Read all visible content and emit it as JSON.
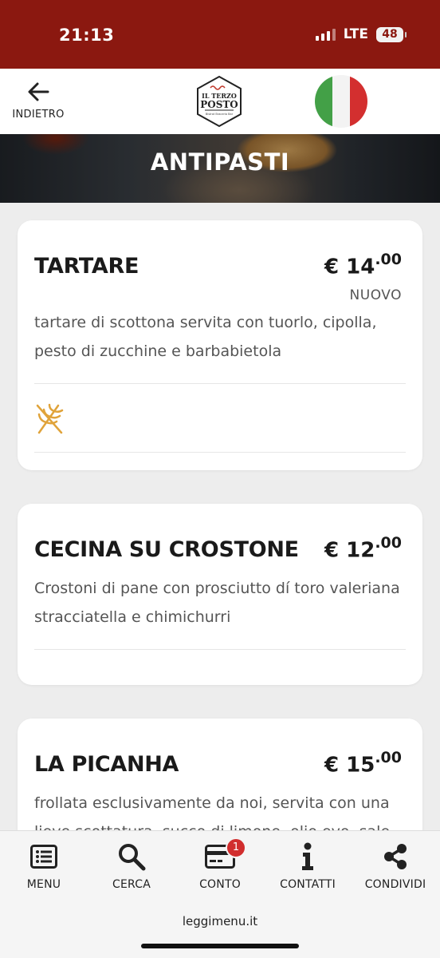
{
  "status_bar": {
    "time": "21:13",
    "network": "LTE",
    "battery": "48"
  },
  "header": {
    "back_label": "INDIETRO",
    "logo_line1": "IL TERZO",
    "logo_line2": "POSTO",
    "logo_tagline": "Bistrot Braceria Bar"
  },
  "category": {
    "title": "ANTIPASTI"
  },
  "items": [
    {
      "name": "TARTARE",
      "price_main": "€ 14",
      "price_cents": ".00",
      "badge": "NUOVO",
      "description": "tartare di scottona servita con tuorlo, cipolla, pesto di zucchine e barbabietola",
      "allergen_icon": "wheat-icon"
    },
    {
      "name": "CECINA SU CROSTONE",
      "price_main": "€ 12",
      "price_cents": ".00",
      "description": "Crostoni di pane con prosciutto dí toro valeriana stracciatella e chimichurri"
    },
    {
      "name": "LA PICANHA",
      "price_main": "€ 15",
      "price_cents": ".00",
      "description": "frollata esclusivamente da noi, servita con una lieve scottatura, succo di limone, olio evo, sale"
    }
  ],
  "bottom_nav": {
    "menu": "MENU",
    "search": "CERCA",
    "bill": "CONTO",
    "bill_count": "1",
    "contacts": "CONTATTI",
    "share": "CONDIVIDI"
  },
  "footer": {
    "site": "leggimenu.it"
  },
  "colors": {
    "brand": "#8b1810",
    "badge": "#d12d2d",
    "allergen": "#e0a33a"
  }
}
